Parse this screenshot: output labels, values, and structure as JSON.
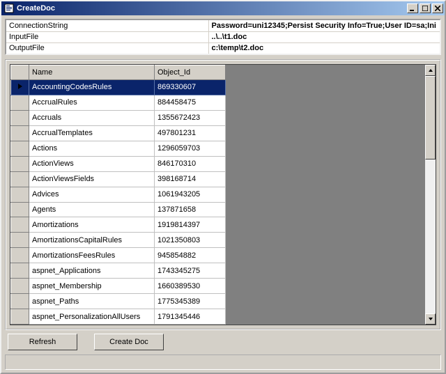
{
  "window": {
    "title": "CreateDoc"
  },
  "props": {
    "rows": [
      {
        "k": "ConnectionString",
        "v": "Password=uni12345;Persist Security Info=True;User ID=sa;Ini"
      },
      {
        "k": "InputFile",
        "v": "..\\..\\t1.doc"
      },
      {
        "k": "OutputFile",
        "v": "c:\\temp\\t2.doc"
      }
    ]
  },
  "grid": {
    "columns": [
      "Name",
      "Object_Id"
    ],
    "selectedIndex": 0,
    "rows": [
      {
        "name": "AccountingCodesRules",
        "objectId": "869330607"
      },
      {
        "name": "AccrualRules",
        "objectId": "884458475"
      },
      {
        "name": "Accruals",
        "objectId": "1355672423"
      },
      {
        "name": "AccrualTemplates",
        "objectId": "497801231"
      },
      {
        "name": "Actions",
        "objectId": "1296059703"
      },
      {
        "name": "ActionViews",
        "objectId": "846170310"
      },
      {
        "name": "ActionViewsFields",
        "objectId": "398168714"
      },
      {
        "name": "Advices",
        "objectId": "1061943205"
      },
      {
        "name": "Agents",
        "objectId": "137871658"
      },
      {
        "name": "Amortizations",
        "objectId": "1919814397"
      },
      {
        "name": "AmortizationsCapitalRules",
        "objectId": "1021350803"
      },
      {
        "name": "AmortizationsFeesRules",
        "objectId": "945854882"
      },
      {
        "name": "aspnet_Applications",
        "objectId": "1743345275"
      },
      {
        "name": "aspnet_Membership",
        "objectId": "1660389530"
      },
      {
        "name": "aspnet_Paths",
        "objectId": "1775345389"
      },
      {
        "name": "aspnet_PersonalizationAllUsers",
        "objectId": "1791345446"
      }
    ]
  },
  "buttons": {
    "refresh": "Refresh",
    "createDoc": "Create Doc"
  }
}
